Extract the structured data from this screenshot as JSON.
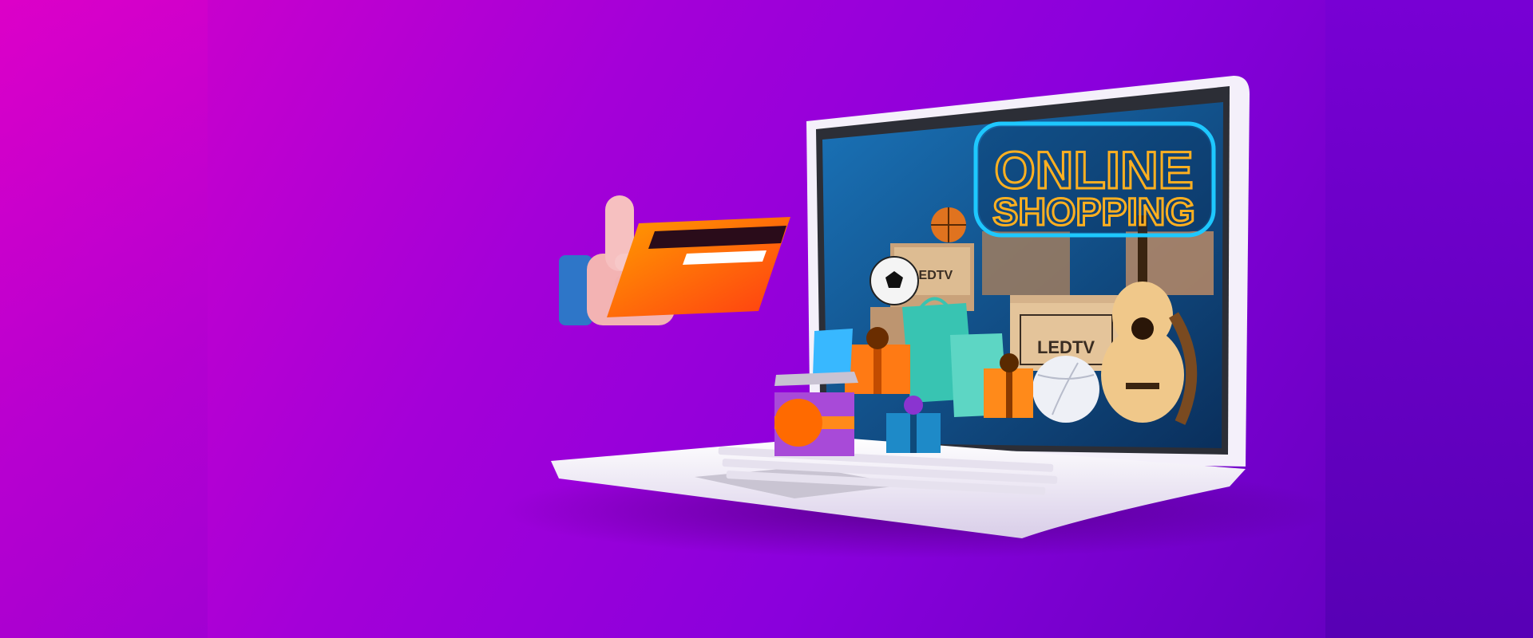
{
  "hero": {
    "sign": {
      "line1": "ONLINE",
      "line2": "SHOPPING"
    },
    "tv_box_label": "LEDTV"
  },
  "colors": {
    "background_start": "#d800c8",
    "background_end": "#5b00b8",
    "neon_outer": "#1ec8ff",
    "neon_text": "#ffb020",
    "laptop_body": "#f1eef6",
    "screen_bg": "#0d4f8a",
    "card": "#ff7a00"
  },
  "icons": {
    "hand": "thumbs-up-hand-icon",
    "card": "credit-card-icon",
    "guitar": "guitar-icon",
    "soccer": "soccer-ball-icon",
    "basketball": "basketball-icon",
    "volleyball": "volleyball-icon"
  }
}
